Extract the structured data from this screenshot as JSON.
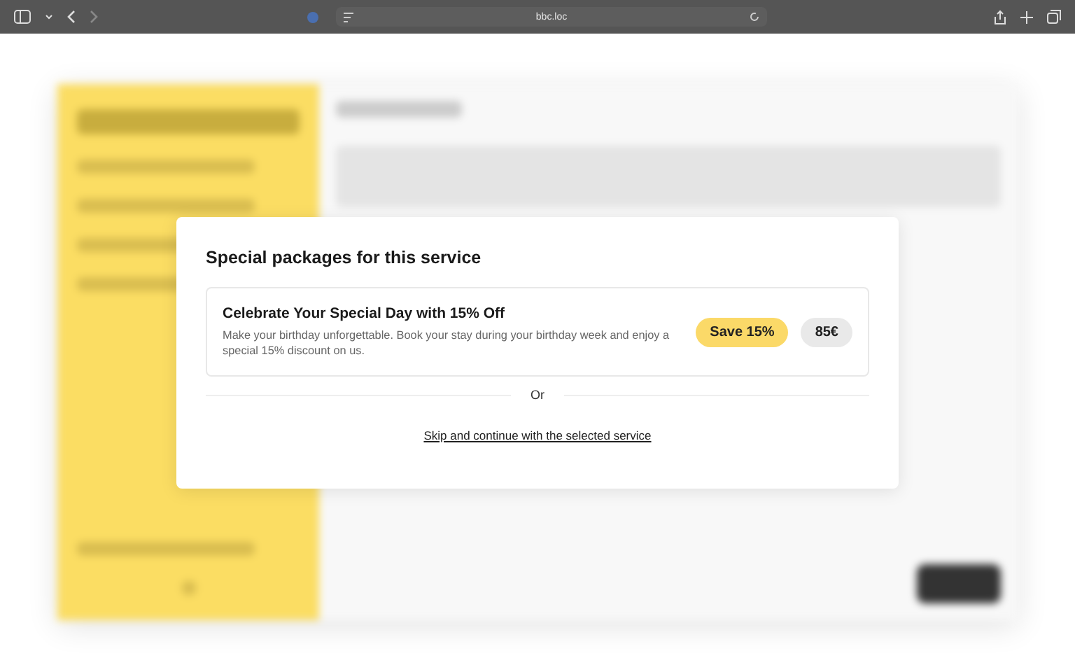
{
  "browser": {
    "address": "bbc.loc"
  },
  "dialog": {
    "title": "Special packages for this service",
    "packages": [
      {
        "title": "Celebrate Your Special Day with 15% Off",
        "description": "Make your birthday unforgettable. Book your stay during your birthday week and enjoy a special 15% discount on us.",
        "badge": "Save 15%",
        "price": "85€"
      }
    ],
    "divider_text": "Or",
    "skip_link": "Skip and continue with the selected service"
  }
}
